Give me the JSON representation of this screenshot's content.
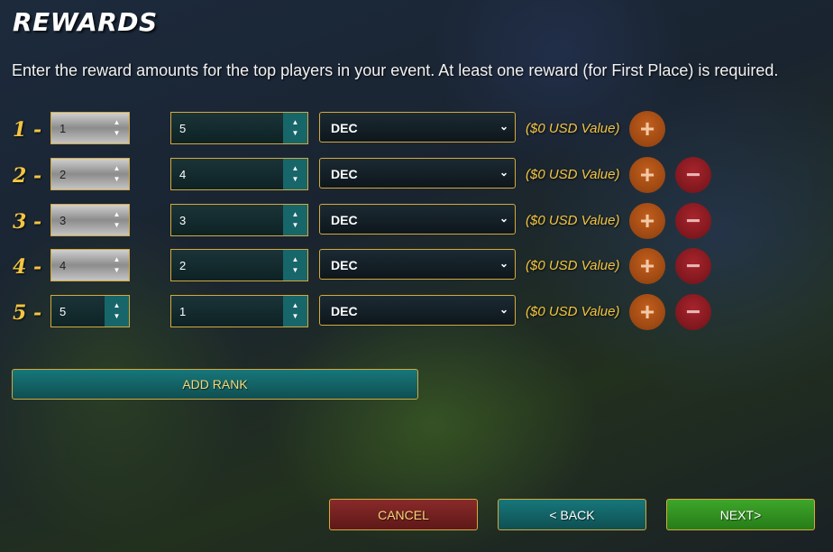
{
  "page": {
    "title": "REWARDS",
    "description": "Enter the reward amounts for the top players in your event. At least one reward (for First Place) is required."
  },
  "rows": [
    {
      "rank_label": "1 -",
      "rank_value": "1",
      "amount": "5",
      "token": "DEC",
      "usd_value": "($0 USD Value)",
      "can_remove": false
    },
    {
      "rank_label": "2 -",
      "rank_value": "2",
      "amount": "4",
      "token": "DEC",
      "usd_value": "($0 USD Value)",
      "can_remove": true
    },
    {
      "rank_label": "3 -",
      "rank_value": "3",
      "amount": "3",
      "token": "DEC",
      "usd_value": "($0 USD Value)",
      "can_remove": true
    },
    {
      "rank_label": "4 -",
      "rank_value": "4",
      "amount": "2",
      "token": "DEC",
      "usd_value": "($0 USD Value)",
      "can_remove": true
    },
    {
      "rank_label": "5 -",
      "rank_value": "5",
      "amount": "1",
      "token": "DEC",
      "usd_value": "($0 USD Value)",
      "can_remove": true
    }
  ],
  "icons": {
    "add": "plus-icon",
    "remove": "minus-icon",
    "spinner_up": "chevron-up-icon",
    "spinner_down": "chevron-down-icon",
    "select": "chevron-down-icon"
  },
  "buttons": {
    "add_rank": "ADD RANK",
    "cancel": "CANCEL",
    "back": "< BACK",
    "next": "NEXT>"
  },
  "colors": {
    "accent_gold": "#f4c542",
    "border_gold": "#d4a93c",
    "teal": "#17666a",
    "plus_orange": "#b3561a",
    "minus_red": "#9a1f27",
    "next_green": "#34961f",
    "cancel_red": "#7a2424"
  }
}
